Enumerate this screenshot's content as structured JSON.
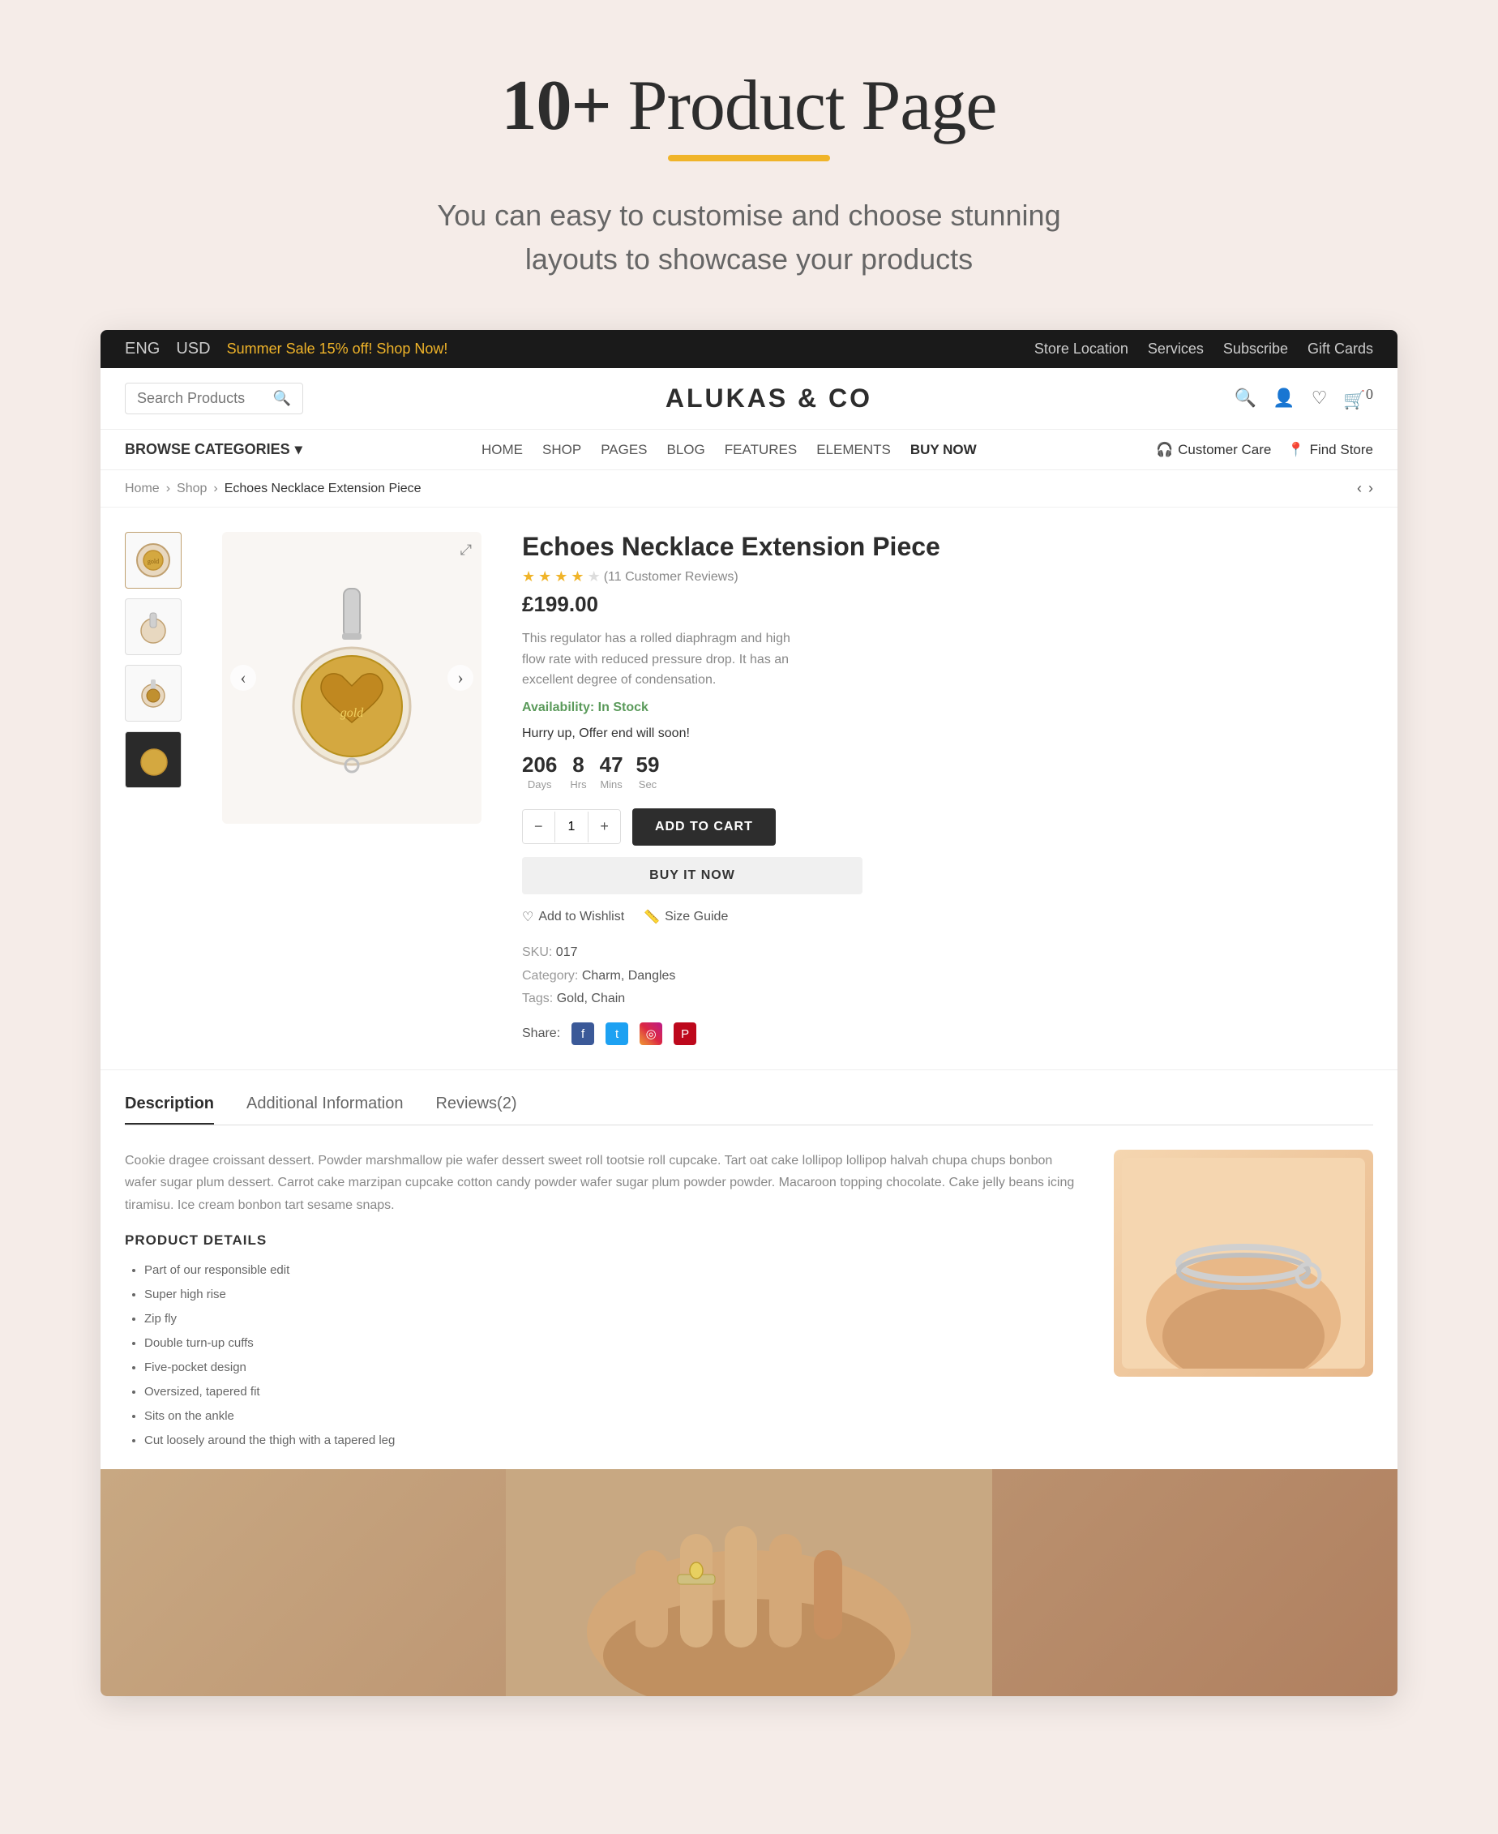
{
  "hero": {
    "title_prefix": "10+",
    "title_suffix": " Product Page",
    "subtitle": "You can easy to customise and choose stunning layouts to showcase your products"
  },
  "topbar": {
    "lang": "ENG",
    "currency": "USD",
    "sale_text": "Summer Sale ",
    "sale_highlight": "15% off!",
    "sale_cta": " Shop Now!",
    "store_location": "Store Location",
    "services": "Services",
    "subscribe": "Subscribe",
    "gift_cards": "Gift Cards"
  },
  "header": {
    "search_placeholder": "Search Products",
    "brand": "ALUKAS & CO",
    "cart_count": "0"
  },
  "navbar": {
    "browse": "BROWSE CATEGORIES",
    "links": [
      "HOME",
      "SHOP",
      "PAGES",
      "BLOG",
      "FEATURES",
      "ELEMENTS",
      "BUY NOW"
    ],
    "customer_care": "Customer Care",
    "find_store": "Find Store"
  },
  "breadcrumb": {
    "home": "Home",
    "shop": "Shop",
    "current": "Echoes Necklace Extension Piece"
  },
  "product": {
    "title": "Echoes Necklace Extension Piece",
    "rating": 4,
    "reviews_count": "11",
    "reviews_label": "Customer Reviews",
    "price": "£199.00",
    "description": "This regulator has a rolled diaphragm and high flow rate with reduced pressure drop. It has an excellent degree of condensation.",
    "availability_label": "Availability:",
    "availability_status": "In Stock",
    "hurry_up": "Hurry up, Offer end will soon!",
    "countdown": {
      "days": "206",
      "days_label": "Days",
      "hours": "8",
      "hours_label": "Hrs",
      "minutes": "47",
      "minutes_label": "Mins",
      "seconds": "59",
      "seconds_label": "Sec"
    },
    "quantity": "1",
    "add_to_cart": "ADD TO CART",
    "buy_it_now": "BUY IT NOW",
    "add_to_wishlist": "Add to Wishlist",
    "size_guide": "Size Guide",
    "sku_label": "SKU:",
    "sku_value": "017",
    "category_label": "Category:",
    "category_value": "Charm, Dangles",
    "tags_label": "Tags:",
    "tags_value": "Gold, Chain",
    "share_label": "Share:"
  },
  "tabs": {
    "description": "Description",
    "additional_info": "Additional Information",
    "reviews": "Reviews(2)"
  },
  "tab_content": {
    "description_text": "Cookie dragee croissant dessert. Powder marshmallow pie wafer dessert sweet roll tootsie roll cupcake. Tart oat cake lollipop lollipop halvah chupa chups bonbon wafer sugar plum dessert. Carrot cake marzipan cupcake cotton candy powder wafer sugar plum powder powder. Macaroon topping chocolate. Cake jelly beans icing tiramisu. Ice cream bonbon tart sesame snaps.",
    "product_details_heading": "PRODUCT DETAILS",
    "product_details_items": [
      "Part of our responsible edit",
      "Super high rise",
      "Zip fly",
      "Double turn-up cuffs",
      "Five-pocket design",
      "Oversized, tapered fit",
      "Sits on the ankle",
      "Cut loosely around the thigh with a tapered leg"
    ]
  }
}
